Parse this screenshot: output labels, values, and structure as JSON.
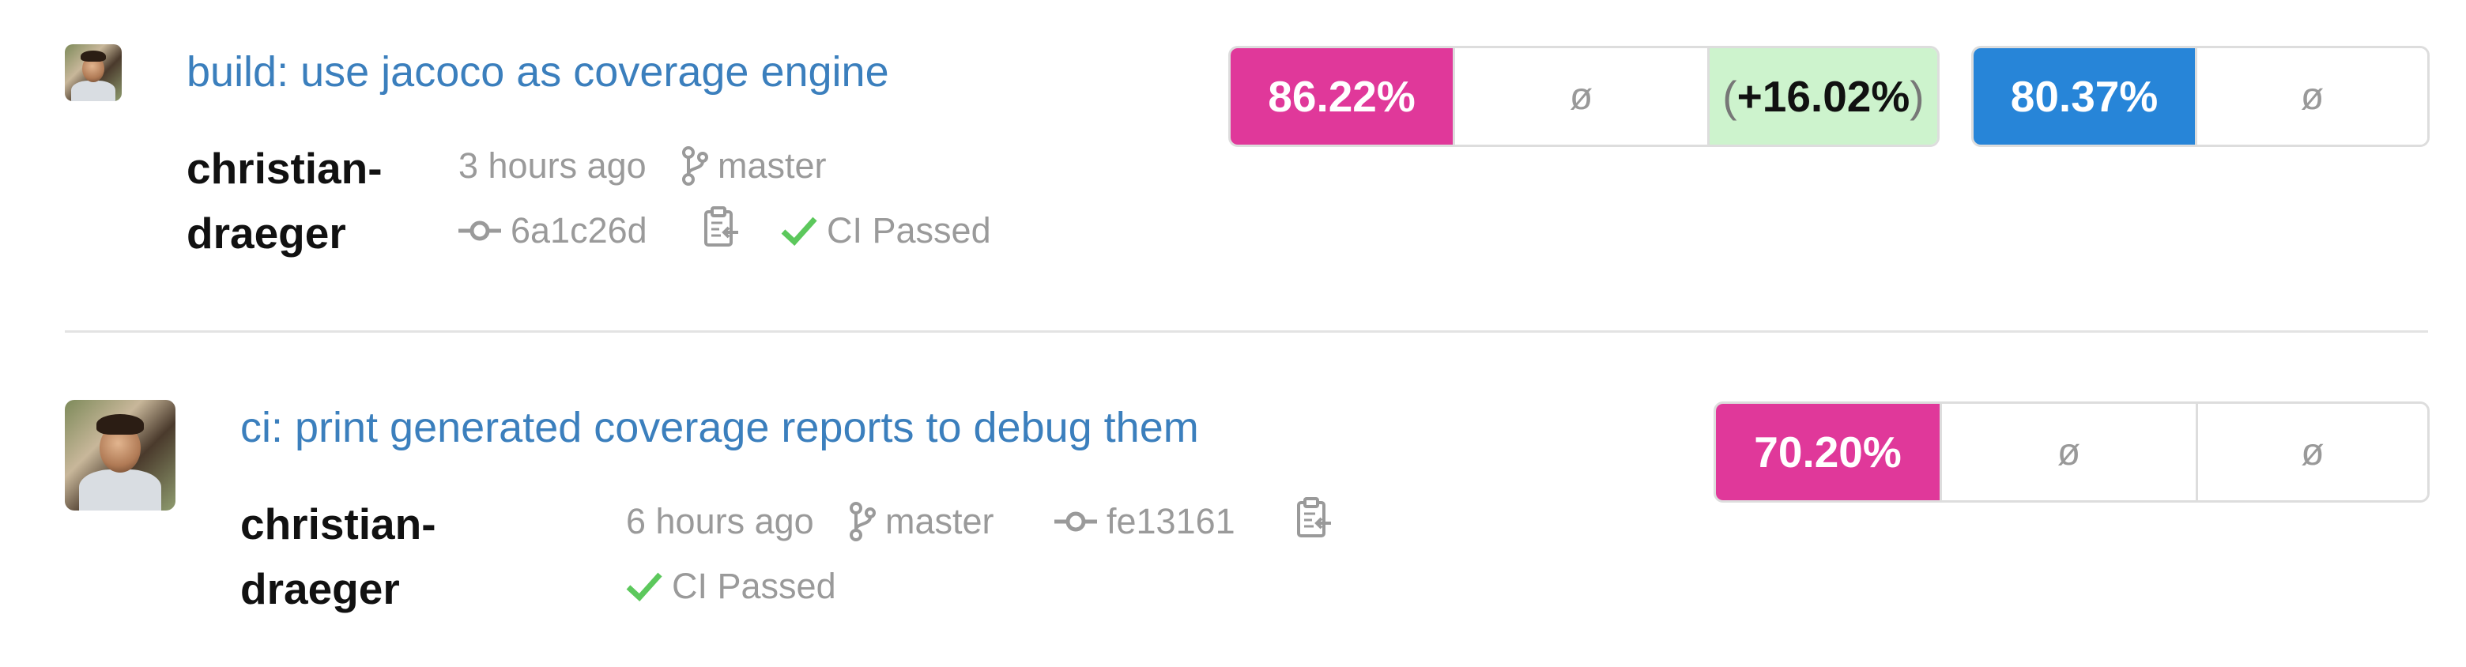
{
  "commits": [
    {
      "title": "build: use jacoco as coverage engine",
      "author_line1": "christian-",
      "author_line2": "draeger",
      "time": "3 hours ago",
      "branch": "master",
      "sha": "6a1c26d",
      "ci_status": "CI Passed",
      "coverage_groups": [
        {
          "cells": [
            {
              "kind": "pink",
              "text": "86.22%"
            },
            {
              "kind": "empty",
              "text": "ø"
            },
            {
              "kind": "delta",
              "text": "+16.02%"
            }
          ]
        },
        {
          "cells": [
            {
              "kind": "blue",
              "text": "80.37%"
            },
            {
              "kind": "empty",
              "text": "ø"
            }
          ]
        }
      ]
    },
    {
      "title": "ci: print generated coverage reports to debug them",
      "author_line1": "christian-",
      "author_line2": "draeger",
      "time": "6 hours ago",
      "branch": "master",
      "sha": "fe13161",
      "ci_status": "CI Passed",
      "coverage_groups": [
        {
          "cells": [
            {
              "kind": "pink",
              "text": "70.20%"
            },
            {
              "kind": "empty",
              "text": "ø"
            },
            {
              "kind": "empty",
              "text": "ø"
            }
          ]
        }
      ]
    }
  ],
  "colors": {
    "link": "#3b7fbd",
    "coverage_pink": "#e0389a",
    "coverage_blue": "#2785d8",
    "delta_bg": "#cdf3cd",
    "ci_passed": "#5cc85c"
  },
  "icons": [
    "git-branch-icon",
    "git-commit-icon",
    "clipboard-copy-icon",
    "check-icon"
  ]
}
